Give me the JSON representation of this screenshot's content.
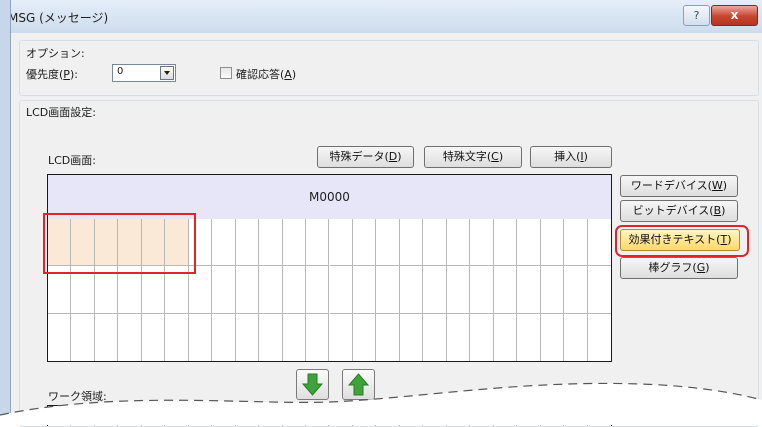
{
  "window": {
    "title": "MSG (メッセージ)",
    "help_glyph": "?",
    "close_glyph": "x"
  },
  "options": {
    "group_label": "オプション:",
    "priority": {
      "label_prefix": "優先度(",
      "mnemonic": "P",
      "label_suffix": "):",
      "value": "0"
    },
    "confirm": {
      "label_prefix": "確認応答(",
      "mnemonic": "A",
      "label_suffix": ")",
      "checked": false
    }
  },
  "lcd_settings": {
    "group_label": "LCD画面設定:",
    "screen_label": "LCD画面:",
    "toolbar": [
      {
        "prefix": "特殊データ(",
        "mnemonic": "D",
        "suffix": ")"
      },
      {
        "prefix": "特殊文字(",
        "mnemonic": "C",
        "suffix": ")"
      },
      {
        "prefix": "挿入(",
        "mnemonic": "I",
        "suffix": ")"
      }
    ],
    "side_buttons": [
      {
        "prefix": "ワードデバイス(",
        "mnemonic": "W",
        "suffix": ")"
      },
      {
        "prefix": "ビットデバイス(",
        "mnemonic": "B",
        "suffix": ")"
      },
      {
        "prefix": "効果付きテキスト(",
        "mnemonic": "T",
        "suffix": ")"
      },
      {
        "prefix": "棒グラフ(",
        "mnemonic": "G",
        "suffix": ")"
      }
    ],
    "header_device": "M0000",
    "grid": {
      "columns": 24,
      "rows": 3,
      "highlight_row": 0,
      "highlight_columns": 6
    },
    "work_area_label": "ワーク領域:"
  },
  "colors": {
    "highlight_fill": "#fae9d6",
    "callout_red": "#e2232a",
    "header_fill": "#e6e6f8"
  }
}
